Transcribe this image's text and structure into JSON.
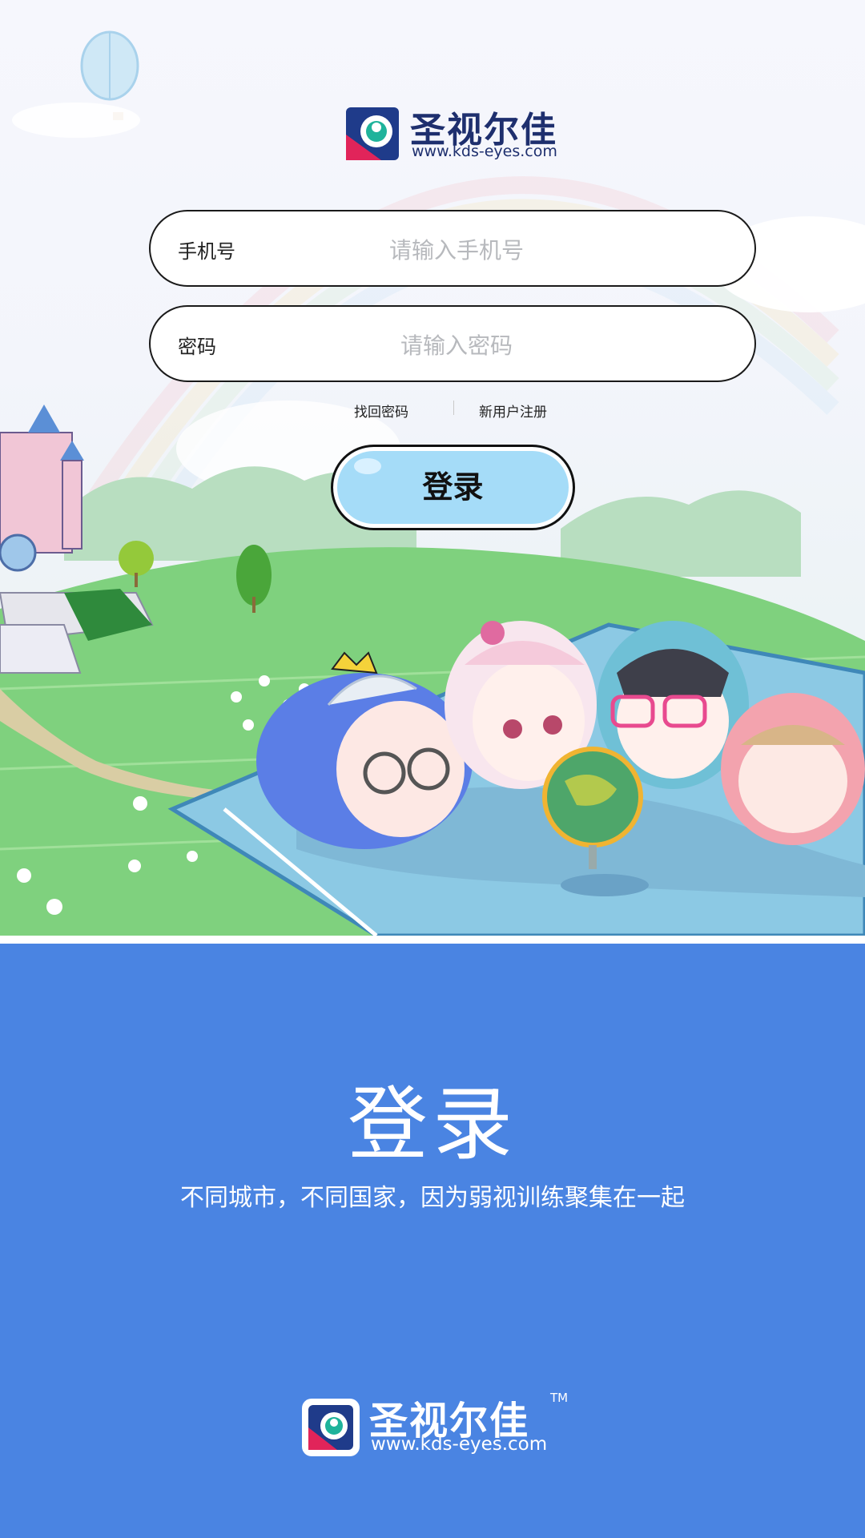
{
  "brand": {
    "name": "圣视尔佳",
    "url": "www.kds-eyes.com",
    "tm": "TM"
  },
  "form": {
    "phone_label": "手机号",
    "phone_placeholder": "请输入手机号",
    "password_label": "密码",
    "password_placeholder": "请输入密码",
    "forgot_link": "找回密码",
    "register_link": "新用户注册",
    "login_button": "登录"
  },
  "banner": {
    "title": "登录",
    "slogan": "不同城市，不同国家，因为弱视训练聚集在一起"
  },
  "colors": {
    "bottom_bg": "#4a84e2",
    "button_fill": "#a5dcf8",
    "brand_navy": "#1e2f6e"
  }
}
